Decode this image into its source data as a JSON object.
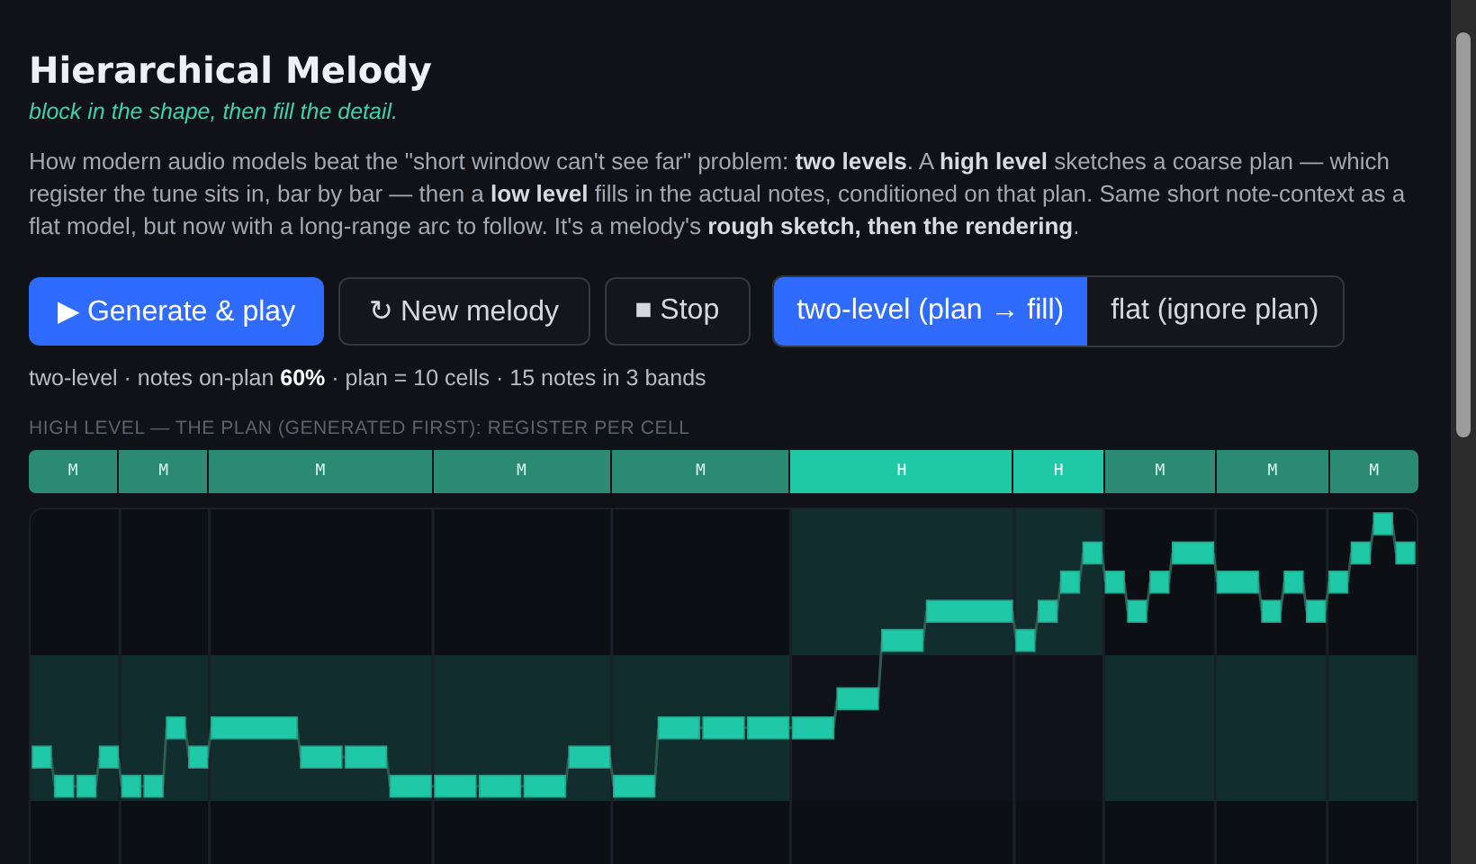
{
  "title": "Hierarchical Melody",
  "subtitle": "block in the shape, then fill the detail.",
  "intro": "How modern audio models beat the \"short window can't see far\" problem: **two levels**. A **high level** sketches a coarse plan — which register the tune sits in, bar by bar — then a **low level** fills in the actual notes, conditioned on that plan. Same short note-context as a flat model, but now with a long-range arc to follow. It's a melody's **rough sketch, then the rendering**.",
  "buttons": [
    {
      "label": "▶ Generate & play",
      "kind": "primary"
    },
    {
      "label": "↻ New melody",
      "kind": "secondary"
    },
    {
      "label": "■ Stop",
      "kind": "secondary"
    }
  ],
  "modes": [
    {
      "label": "two-level (plan → fill)",
      "selected": true
    },
    {
      "label": "flat (ignore plan)",
      "selected": false
    }
  ],
  "stats": "two-level · notes on-plan **60%** · plan = 10 cells · 15 notes in 3 bands",
  "plan": {
    "heading": "HIGH LEVEL — THE PLAN (GENERATED FIRST): REGISTER PER CELL",
    "cells": [
      {
        "label": "M",
        "kind": "mid"
      },
      {
        "label": "M",
        "kind": "mid"
      },
      {
        "label": "M",
        "kind": "mid"
      },
      {
        "label": "M",
        "kind": "mid"
      },
      {
        "label": "M",
        "kind": "mid"
      },
      {
        "label": "H",
        "kind": "high"
      },
      {
        "label": "H",
        "kind": "high"
      },
      {
        "label": "M",
        "kind": "mid"
      },
      {
        "label": "M",
        "kind": "mid"
      },
      {
        "label": "M",
        "kind": "mid"
      }
    ]
  }
}
